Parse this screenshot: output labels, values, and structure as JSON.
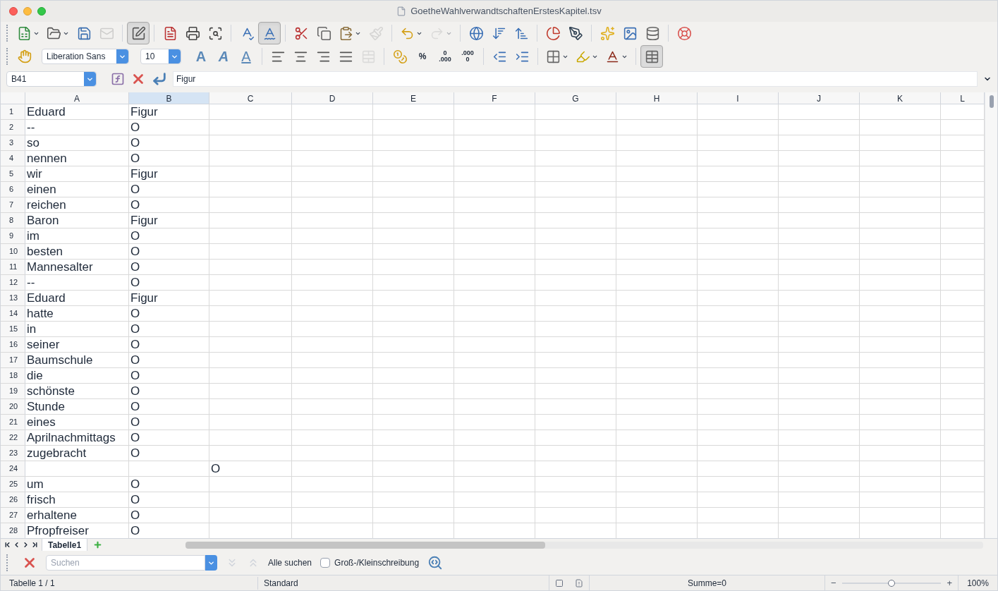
{
  "window": {
    "title": "GoetheWahlverwandtschaftenErstesKapitel.tsv"
  },
  "toolbar_1": [
    {
      "kind": "new",
      "pressed": false,
      "disabled": false,
      "dropdown": true
    },
    {
      "kind": "open",
      "pressed": false,
      "disabled": false,
      "dropdown": true
    },
    {
      "kind": "save",
      "pressed": false,
      "disabled": false,
      "dropdown": false
    },
    {
      "kind": "mail",
      "pressed": false,
      "disabled": true,
      "dropdown": false
    },
    {
      "kind": "sep"
    },
    {
      "kind": "edit",
      "pressed": true,
      "disabled": false,
      "dropdown": false
    },
    {
      "kind": "sep"
    },
    {
      "kind": "pdf",
      "pressed": false,
      "disabled": false,
      "dropdown": false
    },
    {
      "kind": "print",
      "pressed": false,
      "disabled": false,
      "dropdown": false
    },
    {
      "kind": "preview",
      "pressed": false,
      "disabled": false,
      "dropdown": false
    },
    {
      "kind": "sep"
    },
    {
      "kind": "spell",
      "pressed": false,
      "disabled": false,
      "dropdown": false
    },
    {
      "kind": "autospell",
      "pressed": true,
      "disabled": false,
      "dropdown": false
    },
    {
      "kind": "sep"
    },
    {
      "kind": "cut",
      "pressed": false,
      "disabled": false,
      "dropdown": false
    },
    {
      "kind": "copy",
      "pressed": false,
      "disabled": false,
      "dropdown": false
    },
    {
      "kind": "paste",
      "pressed": false,
      "disabled": false,
      "dropdown": true
    },
    {
      "kind": "brush",
      "pressed": false,
      "disabled": true,
      "dropdown": false
    },
    {
      "kind": "sep"
    },
    {
      "kind": "undo",
      "pressed": false,
      "disabled": false,
      "dropdown": true
    },
    {
      "kind": "redo",
      "pressed": false,
      "disabled": true,
      "dropdown": true
    },
    {
      "kind": "sep"
    },
    {
      "kind": "globe",
      "pressed": false,
      "disabled": false,
      "dropdown": false
    },
    {
      "kind": "sortdown",
      "pressed": false,
      "disabled": false,
      "dropdown": false
    },
    {
      "kind": "sortup",
      "pressed": false,
      "disabled": false,
      "dropdown": false
    },
    {
      "kind": "sep"
    },
    {
      "kind": "chart",
      "pressed": false,
      "disabled": false,
      "dropdown": false
    },
    {
      "kind": "draw",
      "pressed": false,
      "disabled": false,
      "dropdown": false
    },
    {
      "kind": "sep"
    },
    {
      "kind": "star",
      "pressed": false,
      "disabled": false,
      "dropdown": false
    },
    {
      "kind": "image",
      "pressed": false,
      "disabled": false,
      "dropdown": false
    },
    {
      "kind": "data",
      "pressed": false,
      "disabled": false,
      "dropdown": false
    },
    {
      "kind": "sep"
    },
    {
      "kind": "help",
      "pressed": false,
      "disabled": false,
      "dropdown": false
    }
  ],
  "toolbar_2": {
    "font_name": "Liberation Sans",
    "font_size": "10",
    "items": [
      {
        "kind": "bold",
        "glyph": "A",
        "pressed": false,
        "disabled": false,
        "dropdown": false
      },
      {
        "kind": "italic",
        "glyph": "A",
        "pressed": false,
        "disabled": false,
        "dropdown": false
      },
      {
        "kind": "underline",
        "glyph": "A",
        "pressed": false,
        "disabled": false,
        "dropdown": false
      },
      {
        "kind": "sep"
      },
      {
        "kind": "alignleft",
        "pressed": false,
        "disabled": false,
        "dropdown": false
      },
      {
        "kind": "aligncenter",
        "pressed": false,
        "disabled": false,
        "dropdown": false
      },
      {
        "kind": "alignright",
        "pressed": false,
        "disabled": false,
        "dropdown": false
      },
      {
        "kind": "justify",
        "pressed": false,
        "disabled": false,
        "dropdown": false
      },
      {
        "kind": "merge",
        "pressed": false,
        "disabled": true,
        "dropdown": false
      },
      {
        "kind": "sep"
      },
      {
        "kind": "currency",
        "pressed": false,
        "disabled": false,
        "dropdown": false
      },
      {
        "kind": "percent",
        "glyph": "%",
        "pressed": false,
        "disabled": false,
        "dropdown": false
      },
      {
        "kind": "adddecimal",
        "glyph": "0 .000",
        "pressed": false,
        "disabled": false,
        "dropdown": false
      },
      {
        "kind": "deldecimal",
        "glyph": ".000 0",
        "pressed": false,
        "disabled": false,
        "dropdown": false
      },
      {
        "kind": "sep"
      },
      {
        "kind": "outdent",
        "pressed": false,
        "disabled": false,
        "dropdown": false
      },
      {
        "kind": "indent",
        "pressed": false,
        "disabled": false,
        "dropdown": false
      },
      {
        "kind": "sep"
      },
      {
        "kind": "borders",
        "pressed": false,
        "disabled": false,
        "dropdown": true
      },
      {
        "kind": "background",
        "pressed": false,
        "disabled": false,
        "dropdown": true
      },
      {
        "kind": "fontcolor",
        "pressed": false,
        "disabled": false,
        "dropdown": true
      },
      {
        "kind": "sep"
      },
      {
        "kind": "gridlines",
        "pressed": true,
        "disabled": false,
        "dropdown": false
      }
    ]
  },
  "formula_bar": {
    "name_box": "B41",
    "content": "Figur"
  },
  "columns": [
    {
      "label": "A",
      "selected": false
    },
    {
      "label": "B",
      "selected": true
    },
    {
      "label": "C",
      "selected": false
    },
    {
      "label": "D",
      "selected": false
    },
    {
      "label": "E",
      "selected": false
    },
    {
      "label": "F",
      "selected": false
    },
    {
      "label": "G",
      "selected": false
    },
    {
      "label": "H",
      "selected": false
    },
    {
      "label": "I",
      "selected": false
    },
    {
      "label": "J",
      "selected": false
    },
    {
      "label": "K",
      "selected": false
    },
    {
      "label": "L",
      "selected": false
    }
  ],
  "rows": [
    {
      "number": "1",
      "a": "Eduard",
      "b": "Figur"
    },
    {
      "number": "2",
      "a": "--",
      "b": "O"
    },
    {
      "number": "3",
      "a": "so",
      "b": "O"
    },
    {
      "number": "4",
      "a": "nennen",
      "b": "O"
    },
    {
      "number": "5",
      "a": "wir",
      "b": "Figur"
    },
    {
      "number": "6",
      "a": "einen",
      "b": "O"
    },
    {
      "number": "7",
      "a": "reichen",
      "b": "O"
    },
    {
      "number": "8",
      "a": "Baron",
      "b": "Figur"
    },
    {
      "number": "9",
      "a": "im",
      "b": "O"
    },
    {
      "number": "10",
      "a": "besten",
      "b": "O"
    },
    {
      "number": "11",
      "a": "Mannesalter",
      "b": "O"
    },
    {
      "number": "12",
      "a": "--",
      "b": "O"
    },
    {
      "number": "13",
      "a": "Eduard",
      "b": "Figur"
    },
    {
      "number": "14",
      "a": "hatte",
      "b": "O"
    },
    {
      "number": "15",
      "a": "in",
      "b": "O"
    },
    {
      "number": "16",
      "a": "seiner",
      "b": "O"
    },
    {
      "number": "17",
      "a": "Baumschule",
      "b": "O"
    },
    {
      "number": "18",
      "a": "die",
      "b": "O"
    },
    {
      "number": "19",
      "a": "schönste",
      "b": "O"
    },
    {
      "number": "20",
      "a": "Stunde",
      "b": "O"
    },
    {
      "number": "21",
      "a": "eines",
      "b": "O"
    },
    {
      "number": "22",
      "a": "Aprilnachmittags",
      "b": "O"
    },
    {
      "number": "23",
      "a": "zugebracht",
      "b": "O"
    },
    {
      "number": "24",
      "c": "O"
    },
    {
      "number": "25",
      "a": "um",
      "b": "O"
    },
    {
      "number": "26",
      "a": "frisch",
      "b": "O"
    },
    {
      "number": "27",
      "a": "erhaltene",
      "b": "O"
    },
    {
      "number": "28",
      "a": "Pfropfreiser",
      "b": "O"
    }
  ],
  "sheet_tabs": [
    {
      "label": "Tabelle1",
      "selected": true
    }
  ],
  "find_bar": {
    "placeholder": "Suchen",
    "find_all": "Alle suchen",
    "match_case": {
      "label": "Groß-/Kleinschreibung",
      "checked": false
    }
  },
  "status_bar": {
    "sheet": "Tabelle 1 / 1",
    "style": "Standard",
    "sum": "Summe=0",
    "zoom_out": "−",
    "zoom_in": "+",
    "zoom": {
      "level": 0.5
    },
    "zoom_label": "100%"
  }
}
